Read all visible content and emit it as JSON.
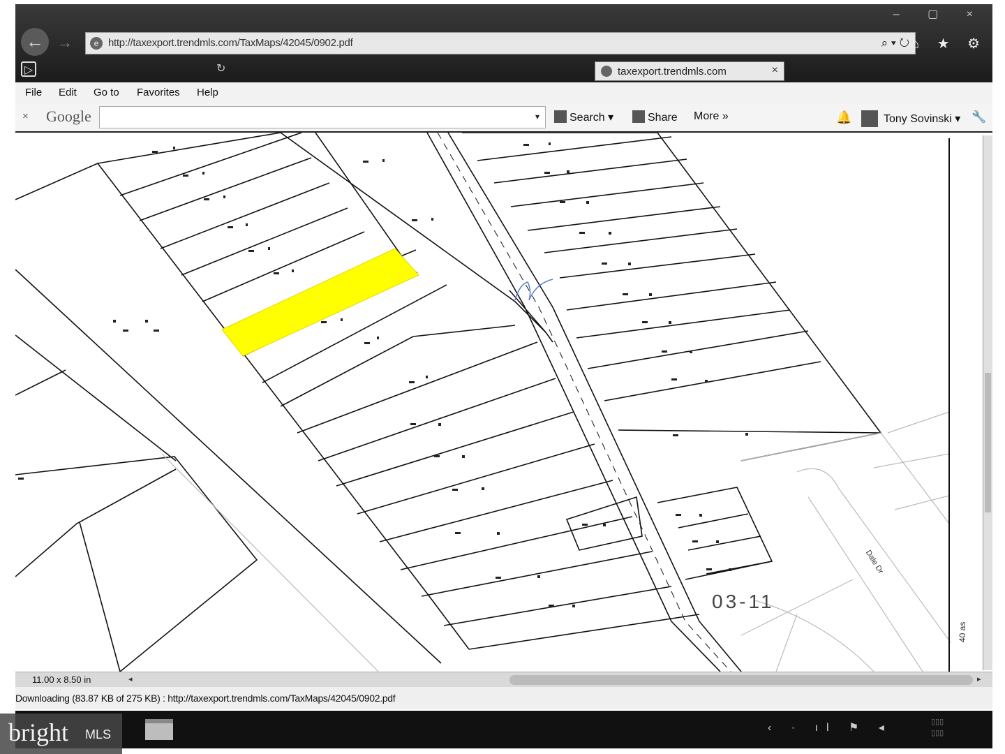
{
  "browser": {
    "url": "http://taxexport.trendmls.com/TaxMaps/42045/0902.pdf",
    "tab_title": "taxexport.trendmls.com",
    "tab_close": "×",
    "address_controls": "⌕ ▾ ↻",
    "nav_icons": "⌂ ★ ⚙",
    "window_controls": "– ▢ ×"
  },
  "menu": {
    "items": [
      "File",
      "Edit",
      "Go to",
      "Favorites",
      "Help"
    ]
  },
  "google_toolbar": {
    "close": "×",
    "logo": "Google",
    "search_value": "",
    "dropdown": "▾",
    "search_label": "Search ▾",
    "share_label": "Share",
    "more_label": "More »",
    "user_name": "Tony Sovinski ▾"
  },
  "map": {
    "parcel_label": "03-11",
    "street_label": "Dale Dr",
    "scale_label": "40 as",
    "highlight_color": "#ffff00"
  },
  "pdf": {
    "page_size": "11.00 x 8.50 in",
    "left_arrow": "◂",
    "right_arrow": "▸"
  },
  "status": {
    "text": "Downloading (83.87 KB of 275 KB) : http://taxexport.trendmls.com/TaxMaps/42045/0902.pdf"
  },
  "watermark": {
    "brand": "bright",
    "suffix": "MLS"
  }
}
